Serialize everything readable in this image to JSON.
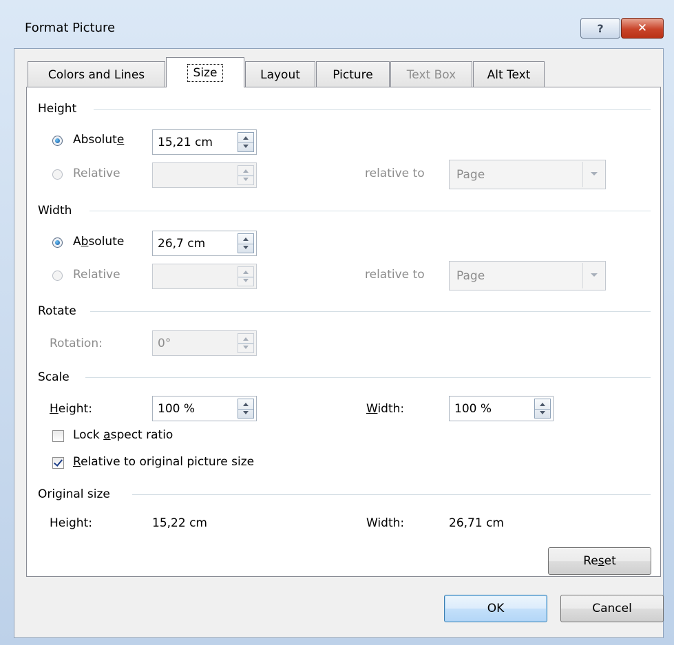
{
  "dialog": {
    "title": "Format Picture",
    "help_label": "?",
    "close_label": "✕"
  },
  "tabs": [
    {
      "label": "Colors and Lines",
      "selected": false,
      "enabled": true
    },
    {
      "label": "Size",
      "selected": true,
      "enabled": true
    },
    {
      "label": "Layout",
      "selected": false,
      "enabled": true
    },
    {
      "label": "Picture",
      "selected": false,
      "enabled": true
    },
    {
      "label": "Text Box",
      "selected": false,
      "enabled": false
    },
    {
      "label": "Alt Text",
      "selected": false,
      "enabled": true
    }
  ],
  "height_group": {
    "title": "Height",
    "absolute": {
      "pre": "Absolut",
      "mnemonic": "e",
      "post": "",
      "value": "15,21 cm",
      "checked": true
    },
    "relative": {
      "label": "Relative",
      "value": "",
      "checked": false,
      "enabled": false
    },
    "relative_to_label": "relative to",
    "relative_to_value": "Page"
  },
  "width_group": {
    "title": "Width",
    "absolute": {
      "pre": "A",
      "mnemonic": "b",
      "post": "solute",
      "value": "26,7 cm",
      "checked": true
    },
    "relative": {
      "label": "Relative",
      "value": "",
      "checked": false,
      "enabled": false
    },
    "relative_to_label": "relative to",
    "relative_to_value": "Page"
  },
  "rotate_group": {
    "title": "Rotate",
    "rotation_label": "Rotation:",
    "rotation_value": "0°"
  },
  "scale_group": {
    "title": "Scale",
    "height": {
      "pre": "",
      "mnemonic": "H",
      "post": "eight:",
      "value": "100 %"
    },
    "width": {
      "pre": "",
      "mnemonic": "W",
      "post": "idth:",
      "value": "100 %"
    },
    "lock_aspect": {
      "pre": "Lock ",
      "mnemonic": "a",
      "post": "spect ratio",
      "checked": false
    },
    "relative_original": {
      "pre": "",
      "mnemonic": "R",
      "post": "elative to original picture size",
      "checked": true
    }
  },
  "original_group": {
    "title": "Original size",
    "height_label": "Height:",
    "height_value": "15,22 cm",
    "width_label": "Width:",
    "width_value": "26,71 cm"
  },
  "reset_button": {
    "pre": "Re",
    "mnemonic": "s",
    "post": "et"
  },
  "ok_label": "OK",
  "cancel_label": "Cancel"
}
